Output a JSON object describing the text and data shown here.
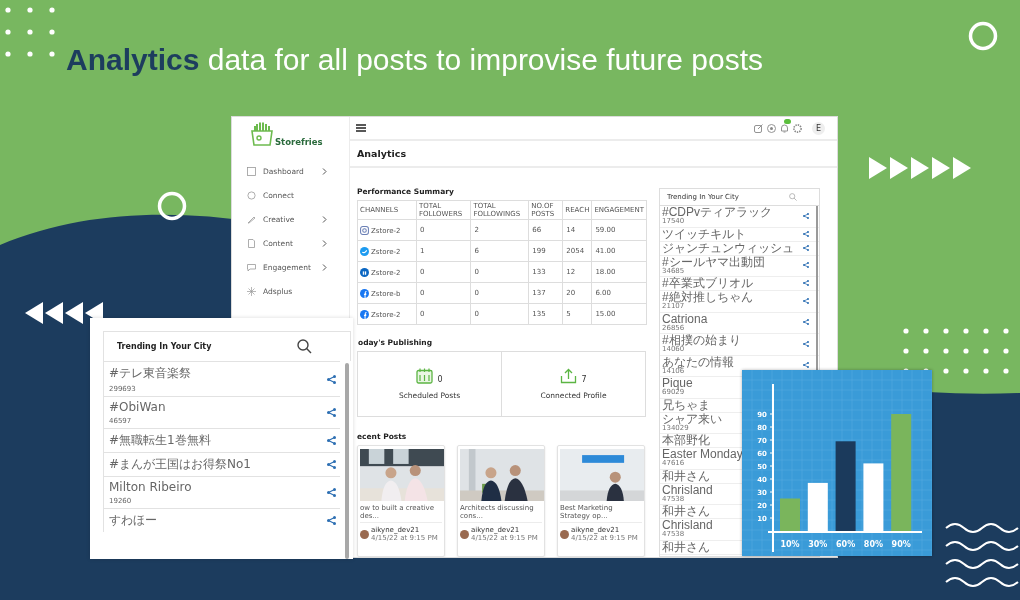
{
  "headline": "**Analytics** data for all posts to improvise future posts",
  "app": {
    "brand": "Storefries",
    "sidebar": [
      {
        "kind": "dashboard",
        "label": "Dashboard",
        "has_submenu": true
      },
      {
        "kind": "connect",
        "label": "Connect",
        "has_submenu": false
      },
      {
        "kind": "creative",
        "label": "Creative",
        "has_submenu": true
      },
      {
        "kind": "content",
        "label": "Content",
        "has_submenu": true
      },
      {
        "kind": "engagement",
        "label": "Engagement",
        "has_submenu": true
      },
      {
        "kind": "adsplus",
        "label": "Adsplus",
        "has_submenu": false
      }
    ],
    "topbar": {
      "avatar": "E",
      "notification_badge": true
    },
    "page_title": "Analytics",
    "performance": {
      "title": "Performance Summary",
      "columns": [
        "CHANNELS",
        "TOTAL FOLLOWERS",
        "TOTAL FOLLOWINGS",
        "NO.OF POSTS",
        "REACH",
        "ENGAGEMENT"
      ],
      "rows": [
        {
          "kind": "instagram",
          "cells": [
            "Zstore-2",
            "0",
            "2",
            "66",
            "14",
            "59.00"
          ]
        },
        {
          "kind": "twitter",
          "cells": [
            "Zstore-2",
            "1",
            "6",
            "199",
            "2054",
            "41.00"
          ]
        },
        {
          "kind": "linkedin",
          "cells": [
            "Zstore-2",
            "0",
            "0",
            "133",
            "12",
            "18.00"
          ]
        },
        {
          "kind": "facebook",
          "cells": [
            "Zstore-b",
            "0",
            "0",
            "137",
            "20",
            "6.00"
          ]
        },
        {
          "kind": "facebook",
          "cells": [
            "Zstore-2",
            "0",
            "0",
            "135",
            "5",
            "15.00"
          ]
        }
      ]
    },
    "publishing": {
      "title": "oday's Publishing",
      "stats": [
        {
          "kind": "calendar",
          "value": "0",
          "label": "Scheduled Posts"
        },
        {
          "kind": "upload",
          "value": "7",
          "label": "Connected Profile"
        }
      ]
    },
    "recent": {
      "title": "ecent Posts",
      "posts": [
        {
          "caption": "ow to built a creative des...",
          "author": "aikyne_dev21",
          "date": "4/15/22 at 9:15 PM"
        },
        {
          "caption": "Architects discussing cons...",
          "author": "aikyne_dev21",
          "date": "4/15/22 at 9:15 PM"
        },
        {
          "caption": "Best Marketing Strategy op...",
          "author": "aikyne_dev21",
          "date": "4/15/22 at 9:15 PM"
        }
      ]
    },
    "trending": {
      "title": "Trending In Your City",
      "items": [
        {
          "tag": "#CDPvティアラック",
          "count": "17540"
        },
        {
          "tag": "ツイッチキルト"
        },
        {
          "tag": "ジャンチュンウィッシュ"
        },
        {
          "tag": "#シールヤマ出動団",
          "count": "34685"
        },
        {
          "tag": "#卒業式ブリオル"
        },
        {
          "tag": "#絶対推しちゃん",
          "count": "21107"
        },
        {
          "tag": "Catriona",
          "count": "26856"
        },
        {
          "tag": "#相撲の始まり",
          "count": "14060"
        },
        {
          "tag": "あなたの情報",
          "count": "14106"
        },
        {
          "tag": "Pique",
          "count": "69029"
        },
        {
          "tag": "兄ちゃま"
        },
        {
          "tag": "シャア来い",
          "count": "134029"
        },
        {
          "tag": "本部野化"
        },
        {
          "tag": "Easter Monday",
          "count": "47616"
        },
        {
          "tag": "和井さん"
        },
        {
          "tag": "Chrisland",
          "count": "47538"
        },
        {
          "tag": "和井さん"
        },
        {
          "tag": "Chrisland",
          "count": "47538"
        },
        {
          "tag": "和井さん"
        }
      ]
    }
  },
  "popup": {
    "title": "Trending In Your City",
    "items": [
      {
        "tag": "#テレ東音楽祭",
        "count": "299693"
      },
      {
        "tag": "#ObiWan",
        "count": "46597"
      },
      {
        "tag": "#無職転生1巻無料"
      },
      {
        "tag": "#まんが王国はお得祭No1"
      },
      {
        "tag": "Milton Ribeiro",
        "count": "19260"
      },
      {
        "tag": "すわほー"
      }
    ]
  },
  "chart_card": {
    "chart_data": {
      "type": "bar",
      "categories": [
        "10%",
        "30%",
        "60%",
        "80%",
        "90%"
      ],
      "stacked": true,
      "series": [
        {
          "color": "#7ab55c",
          "values": [
            25,
            null,
            null,
            null,
            90
          ]
        },
        {
          "color": "#ffffff",
          "values": [
            null,
            37,
            null,
            52,
            null
          ]
        },
        {
          "color": "#1b3a5c",
          "values": [
            null,
            null,
            69,
            null,
            null
          ]
        }
      ],
      "grid": true,
      "ylim": [
        0,
        100
      ],
      "yticks": [
        10,
        20,
        30,
        40,
        50,
        60,
        70,
        80,
        90
      ]
    }
  }
}
